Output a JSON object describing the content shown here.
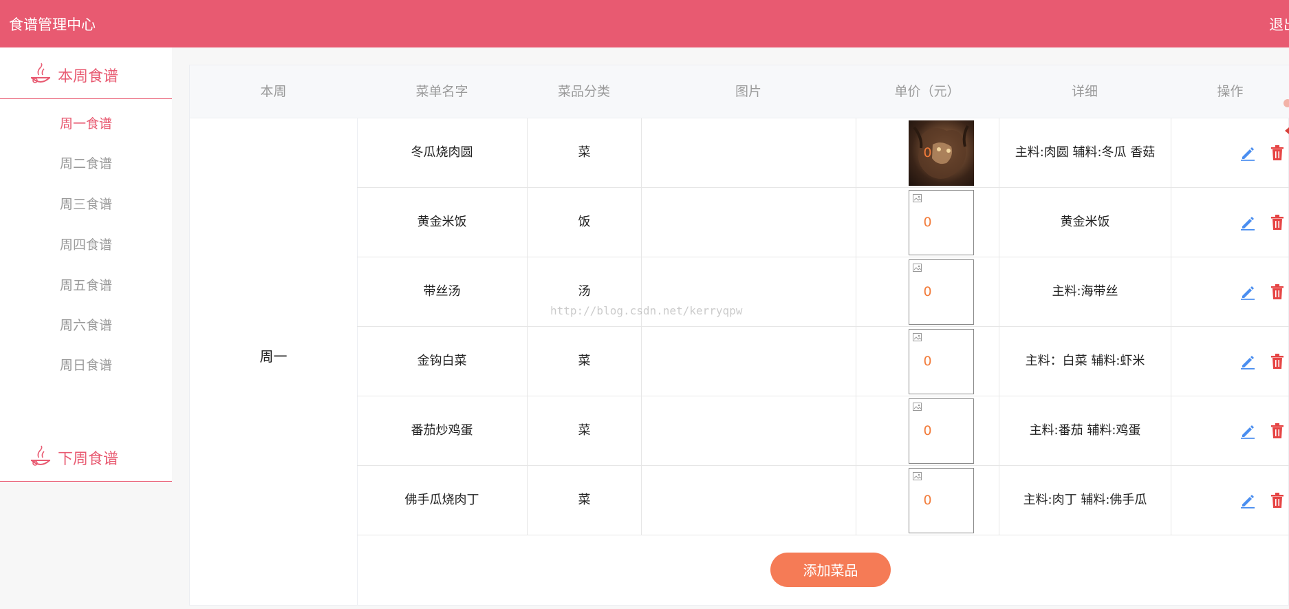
{
  "header": {
    "title": "食谱管理中心",
    "logout": "退出"
  },
  "sidebar": {
    "this_week": "本周食谱",
    "next_week": "下周食谱",
    "days": [
      "周一食谱",
      "周二食谱",
      "周三食谱",
      "周四食谱",
      "周五食谱",
      "周六食谱",
      "周日食谱"
    ]
  },
  "table": {
    "headers": {
      "week": "本周",
      "name": "菜单名字",
      "category": "菜品分类",
      "image": "图片",
      "price": "单价（元）",
      "detail": "详细",
      "action": "操作"
    },
    "week_value": "周一",
    "rows": [
      {
        "name": "冬瓜烧肉圆",
        "category": "菜",
        "price": "0",
        "detail": "主料:肉圆 辅料:冬瓜 香菇"
      },
      {
        "name": "黄金米饭",
        "category": "饭",
        "price": "0",
        "detail": "黄金米饭"
      },
      {
        "name": "带丝汤",
        "category": "汤",
        "price": "0",
        "detail": "主料:海带丝"
      },
      {
        "name": "金钩白菜",
        "category": "菜",
        "price": "0",
        "detail": "主料：白菜 辅料:虾米"
      },
      {
        "name": "番茄炒鸡蛋",
        "category": "菜",
        "price": "0",
        "detail": "主料:番茄 辅料:鸡蛋"
      },
      {
        "name": "佛手瓜烧肉丁",
        "category": "菜",
        "price": "0",
        "detail": "主料:肉丁 辅料:佛手瓜"
      }
    ]
  },
  "add_button": "添加菜品",
  "watermark": "http://blog.csdn.net/kerryqpw",
  "colors": {
    "header": "#e85a71",
    "price": "#f27b3a",
    "edit": "#4a8ef0",
    "delete": "#e64444",
    "button": "#f57b56"
  },
  "icons": {
    "section": "food-bowl-icon",
    "edit": "pencil-icon",
    "delete": "trash-icon"
  }
}
